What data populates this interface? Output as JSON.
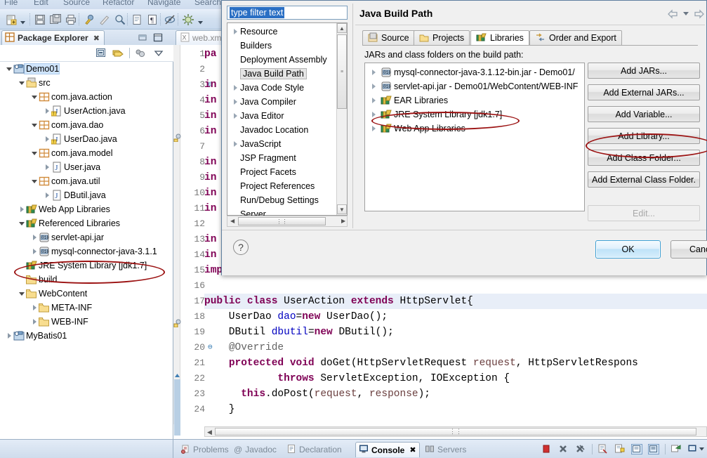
{
  "menubar": {
    "items": [
      "File",
      "Edit",
      "Source",
      "Refactor",
      "Navigate",
      "Search"
    ]
  },
  "toolbar": {
    "icons": [
      {
        "name": "new-wizard-icon",
        "glyph": "📄"
      },
      {
        "name": "new-dropdown-arrow-icon",
        "glyph": "▾"
      },
      {
        "name": "save-icon",
        "glyph": "💾"
      },
      {
        "name": "save-all-icon",
        "glyph": "🗂"
      },
      {
        "name": "print-icon",
        "glyph": "🖨"
      },
      {
        "name": "build-icon",
        "glyph": "🔨"
      },
      {
        "name": "quick-fix-icon",
        "glyph": "✐"
      },
      {
        "name": "search-icon",
        "glyph": "🔍"
      },
      {
        "name": "open-type-icon",
        "glyph": "📋"
      },
      {
        "name": "paragraph-icon",
        "glyph": "¶"
      },
      {
        "name": "toggle-mark-occurrences-icon",
        "glyph": "🚫"
      },
      {
        "name": "debug-icon",
        "glyph": "☀"
      },
      {
        "name": "debug-dropdown-arrow-icon",
        "glyph": "▾"
      }
    ]
  },
  "package_explorer": {
    "tab_label": "Package Explorer",
    "close_glyph": "✖",
    "minimize_title": "Minimize",
    "maximize_title": "Maximize",
    "toolbar": [
      {
        "name": "collapse-all-icon"
      },
      {
        "name": "link-with-editor-icon"
      },
      {
        "name": "focus-on-active-task-icon"
      },
      {
        "name": "view-menu-icon"
      }
    ],
    "tree": [
      {
        "label": "Demo01",
        "indent": 0,
        "twisty": "open",
        "icon": "proj",
        "selected": true
      },
      {
        "label": "src",
        "indent": 1,
        "twisty": "open",
        "icon": "src",
        "selected": false
      },
      {
        "label": "com.java.action",
        "indent": 2,
        "twisty": "open",
        "icon": "pkg",
        "selected": false
      },
      {
        "label": "UserAction.java",
        "indent": 3,
        "twisty": "closed",
        "icon": "java-warn",
        "selected": false
      },
      {
        "label": "com.java.dao",
        "indent": 2,
        "twisty": "open",
        "icon": "pkg",
        "selected": false
      },
      {
        "label": "UserDao.java",
        "indent": 3,
        "twisty": "closed",
        "icon": "java-warn",
        "selected": false
      },
      {
        "label": "com.java.model",
        "indent": 2,
        "twisty": "open",
        "icon": "pkg",
        "selected": false
      },
      {
        "label": "User.java",
        "indent": 3,
        "twisty": "closed",
        "icon": "java",
        "selected": false
      },
      {
        "label": "com.java.util",
        "indent": 2,
        "twisty": "open",
        "icon": "pkg",
        "selected": false
      },
      {
        "label": "DButil.java",
        "indent": 3,
        "twisty": "closed",
        "icon": "java",
        "selected": false
      },
      {
        "label": "Web App Libraries",
        "indent": 1,
        "twisty": "closed",
        "icon": "lib",
        "selected": false
      },
      {
        "label": "Referenced Libraries",
        "indent": 1,
        "twisty": "open",
        "icon": "lib",
        "selected": false
      },
      {
        "label": "servlet-api.jar",
        "indent": 2,
        "twisty": "closed",
        "icon": "jar",
        "selected": false
      },
      {
        "label": "mysql-connector-java-3.1.1",
        "indent": 2,
        "twisty": "closed",
        "icon": "jar",
        "selected": false
      },
      {
        "label": "JRE System Library [jdk1.7]",
        "indent": 1,
        "twisty": "none",
        "icon": "lib",
        "selected": false
      },
      {
        "label": "build",
        "indent": 1,
        "twisty": "none",
        "icon": "folder",
        "selected": false
      },
      {
        "label": "WebContent",
        "indent": 1,
        "twisty": "open",
        "icon": "folder",
        "selected": false
      },
      {
        "label": "META-INF",
        "indent": 2,
        "twisty": "closed",
        "icon": "folder",
        "selected": false
      },
      {
        "label": "WEB-INF",
        "indent": 2,
        "twisty": "closed",
        "icon": "folder",
        "selected": false
      },
      {
        "label": "MyBatis01",
        "indent": 0,
        "twisty": "closed",
        "icon": "proj",
        "selected": false
      }
    ]
  },
  "editor": {
    "tab_label": "web.xml",
    "tab_icon": "xml-file-icon",
    "lines": [
      {
        "no": "1",
        "fold": "",
        "html": "<span class=\"kw\">pa</span>"
      },
      {
        "no": "2",
        "fold": "",
        "html": ""
      },
      {
        "no": "3",
        "fold": "⊖",
        "html": "<span class=\"kw\">in</span>"
      },
      {
        "no": "4",
        "fold": "",
        "html": "<span class=\"kw\">in</span>"
      },
      {
        "no": "5",
        "fold": "",
        "html": "<span class=\"kw\">in</span>"
      },
      {
        "no": "6",
        "fold": "",
        "html": "<span class=\"kw\">in</span>"
      },
      {
        "no": "7",
        "fold": "",
        "html": ""
      },
      {
        "no": "8",
        "fold": "",
        "html": "<span class=\"kw\">in</span>"
      },
      {
        "no": "9",
        "fold": "",
        "html": "<span class=\"kw\">in</span>"
      },
      {
        "no": "10",
        "fold": "",
        "html": "<span class=\"kw\">in</span>"
      },
      {
        "no": "11",
        "fold": "",
        "html": "<span class=\"kw\">in</span>"
      },
      {
        "no": "12",
        "fold": "",
        "html": ""
      },
      {
        "no": "13",
        "fold": "",
        "html": "<span class=\"kw\">in</span>"
      },
      {
        "no": "14",
        "fold": "",
        "html": "<span class=\"kw\">in</span>"
      },
      {
        "no": "15",
        "fold": "",
        "html": "<span class=\"kw\">import</span> com.java.util.DButil;"
      },
      {
        "no": "16",
        "fold": "",
        "html": ""
      },
      {
        "no": "17",
        "fold": "",
        "html": "<span class=\"kw\">public class</span> UserAction <span class=\"kw\">extends</span> HttpServlet{",
        "highlight": true
      },
      {
        "no": "18",
        "fold": "",
        "html": "    UserDao <span class=\"fld\">dao</span>=<span class=\"kw\">new</span> UserDao();"
      },
      {
        "no": "19",
        "fold": "",
        "html": "    DButil <span class=\"fld\">dbutil</span>=<span class=\"kw\">new</span> DButil();"
      },
      {
        "no": "20",
        "fold": "⊖",
        "html": "    <span class=\"an\">@Override</span>"
      },
      {
        "no": "21",
        "fold": "",
        "html": "    <span class=\"kw\">protected void</span> doGet(HttpServletRequest <span class=\"prm\">request</span>, HttpServletRespons"
      },
      {
        "no": "22",
        "fold": "",
        "html": "            <span class=\"kw\">throws</span> ServletException, IOException {"
      },
      {
        "no": "23",
        "fold": "",
        "html": "      <span class=\"kw\">this</span>.doPost(<span class=\"prm\">request</span>, <span class=\"prm\">response</span>);"
      },
      {
        "no": "24",
        "fold": "",
        "html": "    }"
      }
    ]
  },
  "bottom_views": {
    "tabs": [
      {
        "label": "Problems",
        "icon": "problems-icon",
        "active": false
      },
      {
        "label": "Javadoc",
        "icon": "javadoc-icon",
        "active": false
      },
      {
        "label": "Declaration",
        "icon": "declaration-icon",
        "active": false
      },
      {
        "label": "Console",
        "icon": "console-icon",
        "active": true,
        "close_glyph": "✖"
      },
      {
        "label": "Servers",
        "icon": "servers-icon",
        "active": false
      }
    ],
    "actions": [
      {
        "name": "terminate-icon"
      },
      {
        "name": "remove-launch-icon"
      },
      {
        "name": "remove-all-terminated-icon"
      },
      {
        "name": "clear-console-icon"
      },
      {
        "name": "scroll-lock-icon"
      },
      {
        "name": "pin-console-icon"
      },
      {
        "name": "display-selected-console-icon"
      },
      {
        "name": "open-console-icon"
      },
      {
        "name": "console-view-menu-icon"
      },
      {
        "name": "console-menu-arrow-icon"
      }
    ]
  },
  "dialog": {
    "filter": {
      "value": "type filter text",
      "placeholder": "type filter text",
      "selected": true
    },
    "filter_tree": [
      {
        "label": "Resource",
        "twisty": "closed",
        "selected": false
      },
      {
        "label": "Builders",
        "twisty": "none",
        "selected": false
      },
      {
        "label": "Deployment Assembly",
        "twisty": "none",
        "selected": false
      },
      {
        "label": "Java Build Path",
        "twisty": "none",
        "selected": true
      },
      {
        "label": "Java Code Style",
        "twisty": "closed",
        "selected": false
      },
      {
        "label": "Java Compiler",
        "twisty": "closed",
        "selected": false
      },
      {
        "label": "Java Editor",
        "twisty": "closed",
        "selected": false
      },
      {
        "label": "Javadoc Location",
        "twisty": "none",
        "selected": false
      },
      {
        "label": "JavaScript",
        "twisty": "closed",
        "selected": false
      },
      {
        "label": "JSP Fragment",
        "twisty": "none",
        "selected": false
      },
      {
        "label": "Project Facets",
        "twisty": "none",
        "selected": false
      },
      {
        "label": "Project References",
        "twisty": "none",
        "selected": false
      },
      {
        "label": "Run/Debug Settings",
        "twisty": "none",
        "selected": false
      },
      {
        "label": "Server",
        "twisty": "none",
        "selected": false
      }
    ],
    "title": "Java Build Path",
    "nav": {
      "back": "⇐",
      "menu": "▾",
      "forward": "⇒"
    },
    "tabs": [
      {
        "label": "Source",
        "icon": "source-folder-icon",
        "active": false
      },
      {
        "label": "Projects",
        "icon": "projects-icon",
        "active": false
      },
      {
        "label": "Libraries",
        "icon": "libraries-icon",
        "active": true
      },
      {
        "label": "Order and Export",
        "icon": "order-export-icon",
        "active": false
      }
    ],
    "subtitle": "JARs and class folders on the build path:",
    "libraries": [
      {
        "label": "mysql-connector-java-3.1.12-bin.jar - Demo01/",
        "icon": "jar-icon"
      },
      {
        "label": "servlet-api.jar - Demo01/WebContent/WEB-INF",
        "icon": "jar-icon"
      },
      {
        "label": "EAR Libraries",
        "icon": "library-icon"
      },
      {
        "label": "JRE System Library [jdk1.7]",
        "icon": "library-icon"
      },
      {
        "label": "Web App Libraries",
        "icon": "library-icon"
      }
    ],
    "buttons": [
      {
        "label": "Add JARs...",
        "disabled": false
      },
      {
        "label": "Add External JARs...",
        "disabled": false
      },
      {
        "label": "Add Variable...",
        "disabled": false
      },
      {
        "label": "Add Library...",
        "disabled": false
      },
      {
        "label": "Add Class Folder...",
        "disabled": false
      },
      {
        "label": "Add External Class Folder.",
        "disabled": false
      },
      {
        "label": "Edit...",
        "disabled": true
      }
    ],
    "help_glyph": "?",
    "ok_label": "OK",
    "cancel_label": "Cancel"
  },
  "annotations": {
    "color": "#9b1111",
    "ellipses": [
      {
        "name": "jre-system-library-tree-highlight"
      },
      {
        "name": "jre-system-library-list-highlight"
      },
      {
        "name": "add-library-button-highlight"
      }
    ]
  }
}
